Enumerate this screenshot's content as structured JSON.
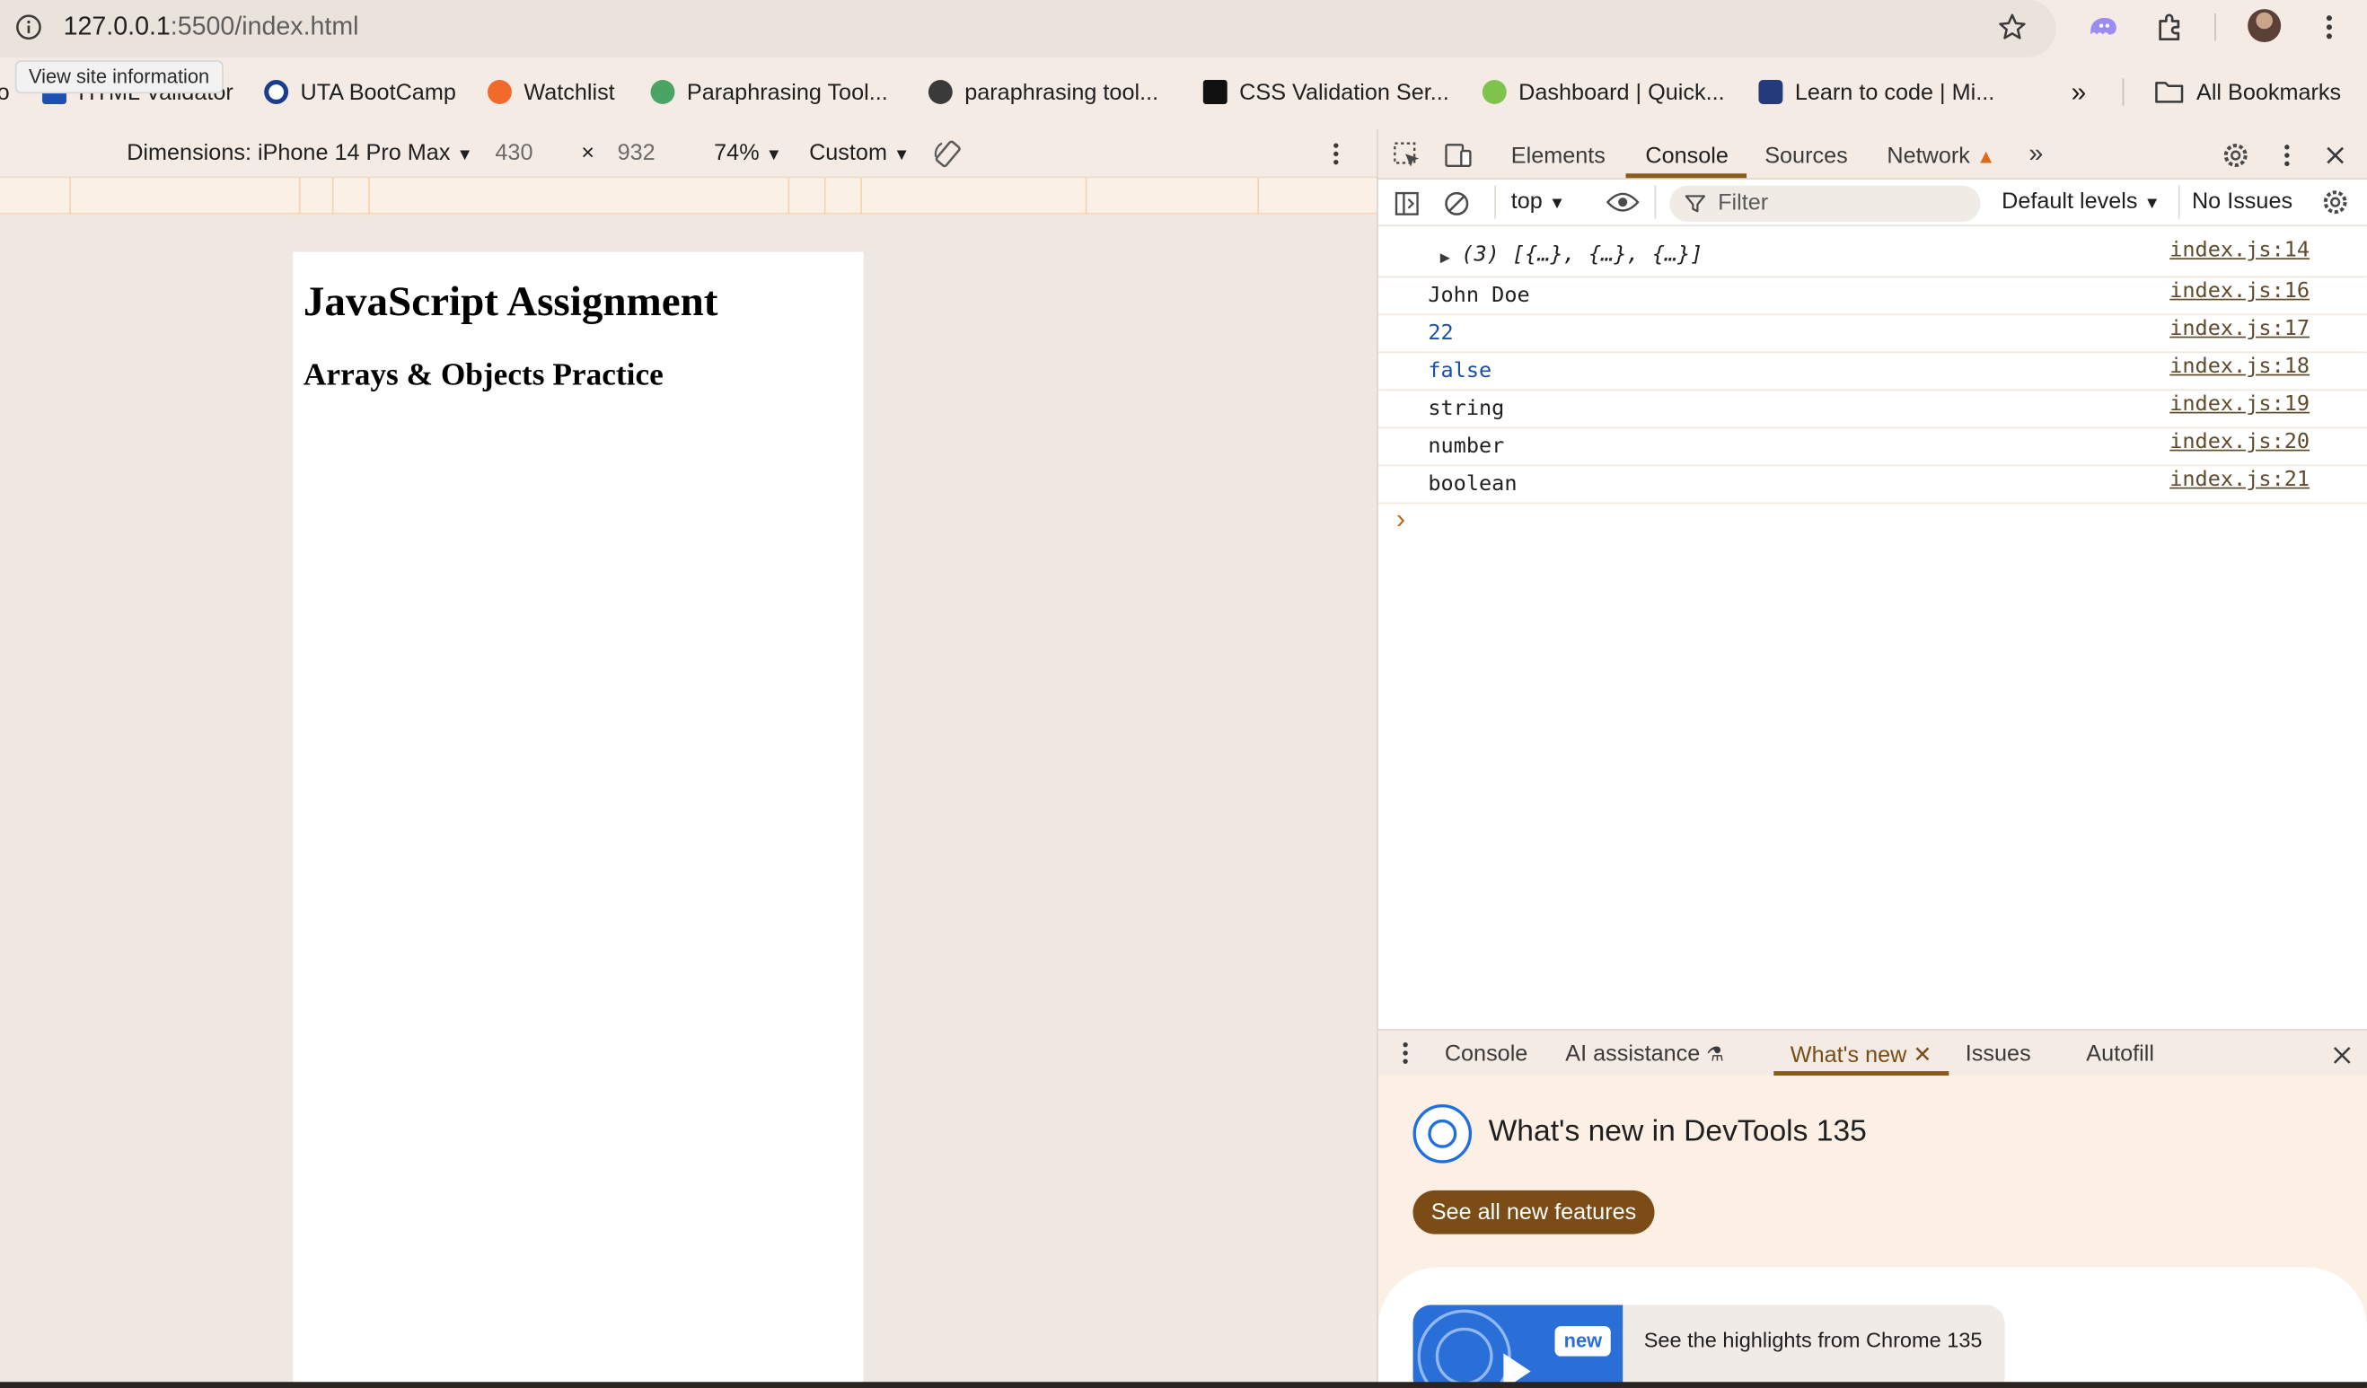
{
  "browser": {
    "url_host": "127.0.0.1",
    "url_path": ":5500/index.html",
    "tooltip": "View site information",
    "bookmarks": [
      "HTML Validator",
      "UTA BootCamp",
      "Watchlist",
      "Paraphrasing Tool...",
      "paraphrasing tool...",
      "CSS Validation Ser...",
      "Dashboard | Quick...",
      "Learn to code | Mi..."
    ],
    "bookmarks_overflow": "»",
    "all_bookmarks": "All Bookmarks"
  },
  "device_toolbar": {
    "dimensions": "Dimensions: iPhone 14 Pro Max",
    "width": "430",
    "times": "×",
    "height": "932",
    "zoom": "74%",
    "throttle": "Custom"
  },
  "page": {
    "heading": "JavaScript Assignment",
    "subheading": "Arrays & Objects Practice"
  },
  "devtools": {
    "tabs": [
      "Elements",
      "Console",
      "Sources",
      "Network"
    ],
    "active_tab": "Console",
    "context": "top",
    "filter_placeholder": "Filter",
    "levels": "Default levels",
    "issues": "No Issues",
    "logs": [
      {
        "msg": "(3) [{…}, {…}, {…}]",
        "src": "index.js:14"
      },
      {
        "msg": "John Doe",
        "src": "index.js:16"
      },
      {
        "msg": "22",
        "src": "index.js:17"
      },
      {
        "msg": "false",
        "src": "index.js:18"
      },
      {
        "msg": "string",
        "src": "index.js:19"
      },
      {
        "msg": "number",
        "src": "index.js:20"
      },
      {
        "msg": "boolean",
        "src": "index.js:21"
      }
    ],
    "prompt": "›",
    "drawer_tabs": [
      "Console",
      "AI assistance",
      "What's new",
      "Issues",
      "Autofill"
    ],
    "whats_new_title": "What's new in DevTools 135",
    "whats_new_button": "See all new features",
    "card_badge": "new",
    "card_text": "See the highlights from Chrome 135"
  }
}
